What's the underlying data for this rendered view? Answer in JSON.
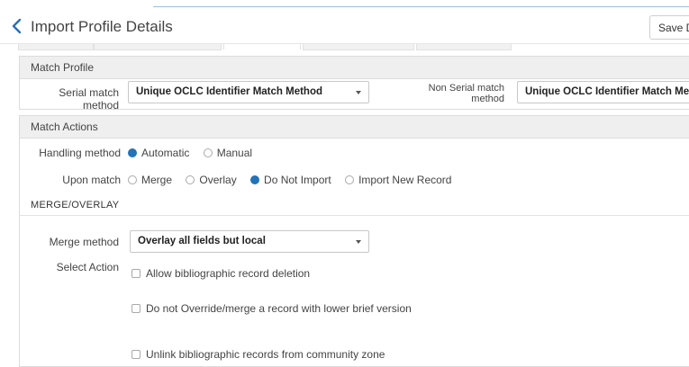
{
  "header": {
    "title": "Import Profile Details",
    "save_label": "Save Dr"
  },
  "match_profile": {
    "section_title": "Match Profile",
    "serial_label": "Serial match method",
    "serial_value": "Unique OCLC Identifier Match Method",
    "non_serial_label_line1": "Non Serial match",
    "non_serial_label_line2": "method",
    "non_serial_value": "Unique OCLC Identifier Match Method"
  },
  "match_actions": {
    "section_title": "Match Actions",
    "handling_label": "Handling method",
    "handling_options": [
      {
        "label": "Automatic",
        "selected": true
      },
      {
        "label": "Manual",
        "selected": false
      }
    ],
    "upon_match_label": "Upon match",
    "upon_match_options": [
      {
        "label": "Merge",
        "selected": false
      },
      {
        "label": "Overlay",
        "selected": false
      },
      {
        "label": "Do Not Import",
        "selected": true
      },
      {
        "label": "Import New Record",
        "selected": false
      }
    ],
    "merge_overlay_heading": "MERGE/OVERLAY",
    "merge_method_label": "Merge method",
    "merge_method_value": "Overlay all fields but local",
    "select_action_label": "Select Action",
    "actions": [
      {
        "label": "Allow bibliographic record deletion",
        "checked": false
      },
      {
        "label": "Do not Override/merge a record with lower brief version",
        "checked": false
      },
      {
        "label": "Unlink bibliographic records from community zone",
        "checked": false
      }
    ]
  },
  "colors": {
    "accent": "#2273b8",
    "section_header_bg": "#efefef",
    "border": "#dcdcdc"
  }
}
